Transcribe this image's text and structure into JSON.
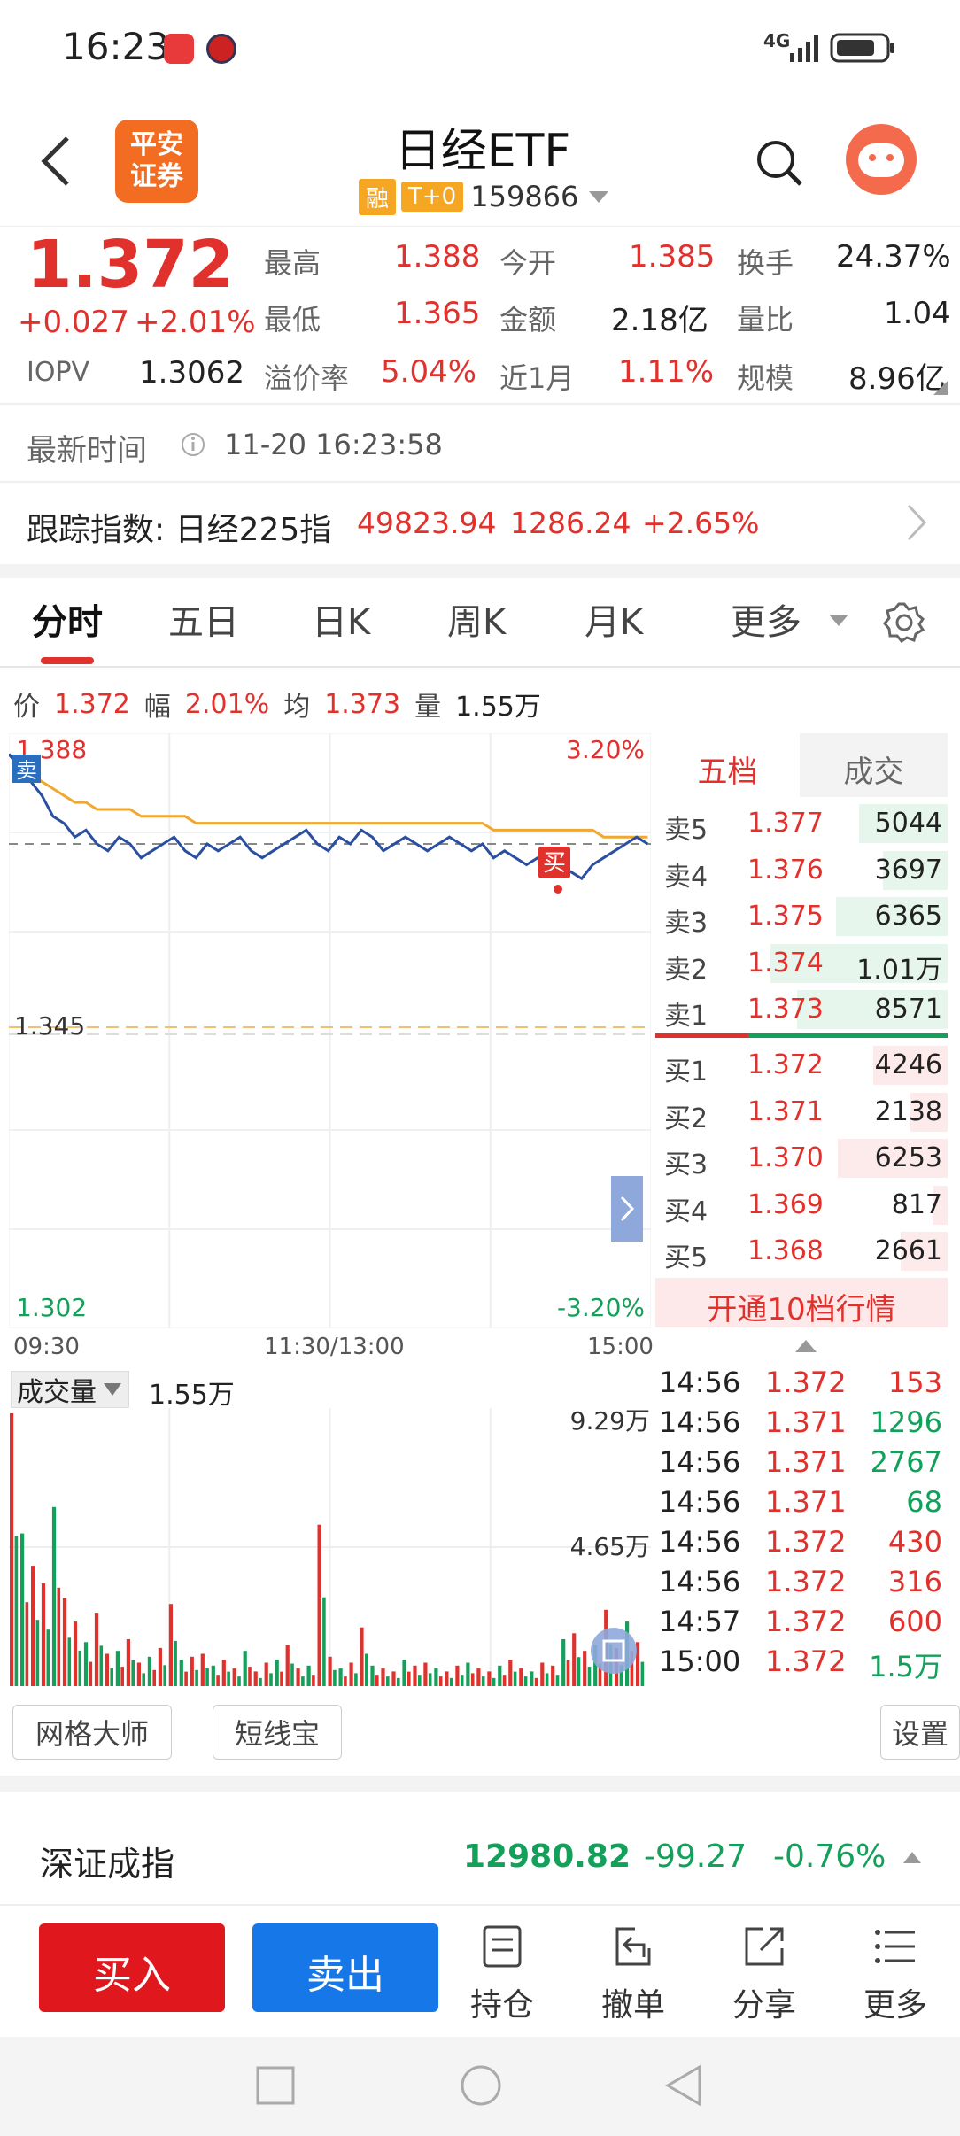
{
  "status_bar": {
    "time": "16:23",
    "network": "4G",
    "notif_icons": [
      "huawei-store-icon",
      "game-app-icon"
    ]
  },
  "header": {
    "logo_text": "平安\n证券",
    "title": "日经ETF",
    "tag_margin": "融",
    "tag_t0": "T+0",
    "code": "159866"
  },
  "quote": {
    "price": "1.372",
    "change": "+0.027",
    "change_pct": "+2.01%",
    "iopv_label": "IOPV",
    "iopv": "1.3062",
    "high_label": "最高",
    "high": "1.388",
    "low_label": "最低",
    "low": "1.365",
    "premium_label": "溢价率",
    "premium": "5.04%",
    "open_label": "今开",
    "open": "1.385",
    "amount_label": "金额",
    "amount": "2.18亿",
    "month_label": "近1月",
    "month": "1.11%",
    "turnover_label": "换手",
    "turnover": "24.37%",
    "vol_ratio_label": "量比",
    "vol_ratio": "1.04",
    "scale_label": "规模",
    "scale": "8.96亿"
  },
  "update": {
    "label": "最新时间",
    "time": "11-20 16:23:58"
  },
  "tracking": {
    "label": "跟踪指数: 日经225指",
    "value": "49823.94",
    "change": "1286.24",
    "change_pct": "+2.65%"
  },
  "tabs": [
    "分时",
    "五日",
    "日K",
    "周K",
    "月K",
    "更多"
  ],
  "summary": {
    "price_label": "价",
    "price": "1.372",
    "amp_label": "幅",
    "amp": "2.01%",
    "avg_label": "均",
    "avg": "1.373",
    "vol_label": "量",
    "vol": "1.55万"
  },
  "chart_labels": {
    "y_top": "1.388",
    "y_mid": "1.345",
    "y_bot": "1.302",
    "pct_top": "3.20%",
    "pct_bot": "-3.20%",
    "sell_marker": "卖",
    "buy_marker": "买",
    "t_start": "09:30",
    "t_mid": "11:30/13:00",
    "t_end": "15:00",
    "vol_label": "成交量",
    "vol_value": "1.55万",
    "vol_max": "9.29万",
    "vol_half": "4.65万"
  },
  "chart_data": {
    "type": "line",
    "title": "",
    "xlabel": "",
    "ylabel": "",
    "ylim": [
      1.302,
      1.388
    ],
    "x_ticks": [
      "09:30",
      "11:30/13:00",
      "15:00"
    ],
    "series": [
      {
        "values": [
          1.385,
          1.383,
          1.381,
          1.379,
          1.376,
          1.375,
          1.373,
          1.374,
          1.372,
          1.371,
          1.373,
          1.372,
          1.37,
          1.371,
          1.372,
          1.373,
          1.371,
          1.37,
          1.372,
          1.371,
          1.372,
          1.373,
          1.371,
          1.37,
          1.371,
          1.372,
          1.373,
          1.374,
          1.372,
          1.371,
          1.373,
          1.372,
          1.374,
          1.373,
          1.371,
          1.372,
          1.373,
          1.372,
          1.371,
          1.372,
          1.373,
          1.372,
          1.371,
          1.372,
          1.37,
          1.371,
          1.37,
          1.369,
          1.37,
          1.368,
          1.369,
          1.368,
          1.367,
          1.369,
          1.37,
          1.371,
          1.372,
          1.373,
          1.372
        ]
      },
      {
        "values": [
          1.385,
          1.383,
          1.382,
          1.381,
          1.38,
          1.379,
          1.378,
          1.378,
          1.377,
          1.377,
          1.377,
          1.377,
          1.376,
          1.376,
          1.376,
          1.376,
          1.376,
          1.375,
          1.375,
          1.375,
          1.375,
          1.375,
          1.375,
          1.375,
          1.375,
          1.375,
          1.375,
          1.375,
          1.375,
          1.375,
          1.375,
          1.375,
          1.375,
          1.375,
          1.375,
          1.375,
          1.375,
          1.375,
          1.375,
          1.375,
          1.375,
          1.375,
          1.375,
          1.375,
          1.374,
          1.374,
          1.374,
          1.374,
          1.374,
          1.374,
          1.374,
          1.374,
          1.374,
          1.374,
          1.373,
          1.373,
          1.373,
          1.373,
          1.373
        ]
      }
    ],
    "volume_ylim": [
      0,
      9.29
    ],
    "volume": [
      9.29,
      5.2,
      4.1,
      3.5,
      6.1,
      3.0,
      2.2,
      1.5,
      2.5,
      1.1,
      1.2,
      1.6,
      0.8,
      1.0,
      1.3,
      2.8,
      0.9,
      1.0,
      1.1,
      0.7,
      0.9,
      0.6,
      1.2,
      0.5,
      0.8,
      0.9,
      1.4,
      0.6,
      0.7,
      5.5,
      1.0,
      0.6,
      0.8,
      2.0,
      0.7,
      0.6,
      0.5,
      0.9,
      0.7,
      0.8,
      0.6,
      0.5,
      0.7,
      0.8,
      0.6,
      0.5,
      0.7,
      0.9,
      0.6,
      0.5,
      0.8,
      0.7,
      1.6,
      1.8,
      1.2,
      1.4,
      2.6,
      1.3,
      2.2,
      1.5
    ]
  },
  "order_book": {
    "tab_active": "五档",
    "tab_other": "成交",
    "sells": [
      {
        "label": "卖5",
        "price": "1.377",
        "vol": "5044"
      },
      {
        "label": "卖4",
        "price": "1.376",
        "vol": "3697"
      },
      {
        "label": "卖3",
        "price": "1.375",
        "vol": "6365"
      },
      {
        "label": "卖2",
        "price": "1.374",
        "vol": "1.01万"
      },
      {
        "label": "卖1",
        "price": "1.373",
        "vol": "8571"
      }
    ],
    "buys": [
      {
        "label": "买1",
        "price": "1.372",
        "vol": "4246"
      },
      {
        "label": "买2",
        "price": "1.371",
        "vol": "2138"
      },
      {
        "label": "买3",
        "price": "1.370",
        "vol": "6253"
      },
      {
        "label": "买4",
        "price": "1.369",
        "vol": "817"
      },
      {
        "label": "买5",
        "price": "1.368",
        "vol": "2661"
      }
    ],
    "upgrade": "开通10档行情"
  },
  "ticks": [
    {
      "time": "14:56",
      "price": "1.372",
      "vol": "153",
      "dir": "red"
    },
    {
      "time": "14:56",
      "price": "1.371",
      "vol": "1296",
      "dir": "green"
    },
    {
      "time": "14:56",
      "price": "1.371",
      "vol": "2767",
      "dir": "green"
    },
    {
      "time": "14:56",
      "price": "1.371",
      "vol": "68",
      "dir": "green"
    },
    {
      "time": "14:56",
      "price": "1.372",
      "vol": "430",
      "dir": "red"
    },
    {
      "time": "14:56",
      "price": "1.372",
      "vol": "316",
      "dir": "red"
    },
    {
      "time": "14:57",
      "price": "1.372",
      "vol": "600",
      "dir": "red"
    },
    {
      "time": "15:00",
      "price": "1.372",
      "vol": "1.5万",
      "dir": "green"
    }
  ],
  "tools": {
    "grid": "网格大师",
    "short": "短线宝",
    "settings": "设置"
  },
  "index_bar": {
    "name": "深证成指",
    "value": "12980.82",
    "change": "-99.27",
    "change_pct": "-0.76%"
  },
  "bottom": {
    "buy": "买入",
    "sell": "卖出",
    "position": "持仓",
    "cancel": "撤单",
    "share": "分享",
    "more": "更多"
  }
}
